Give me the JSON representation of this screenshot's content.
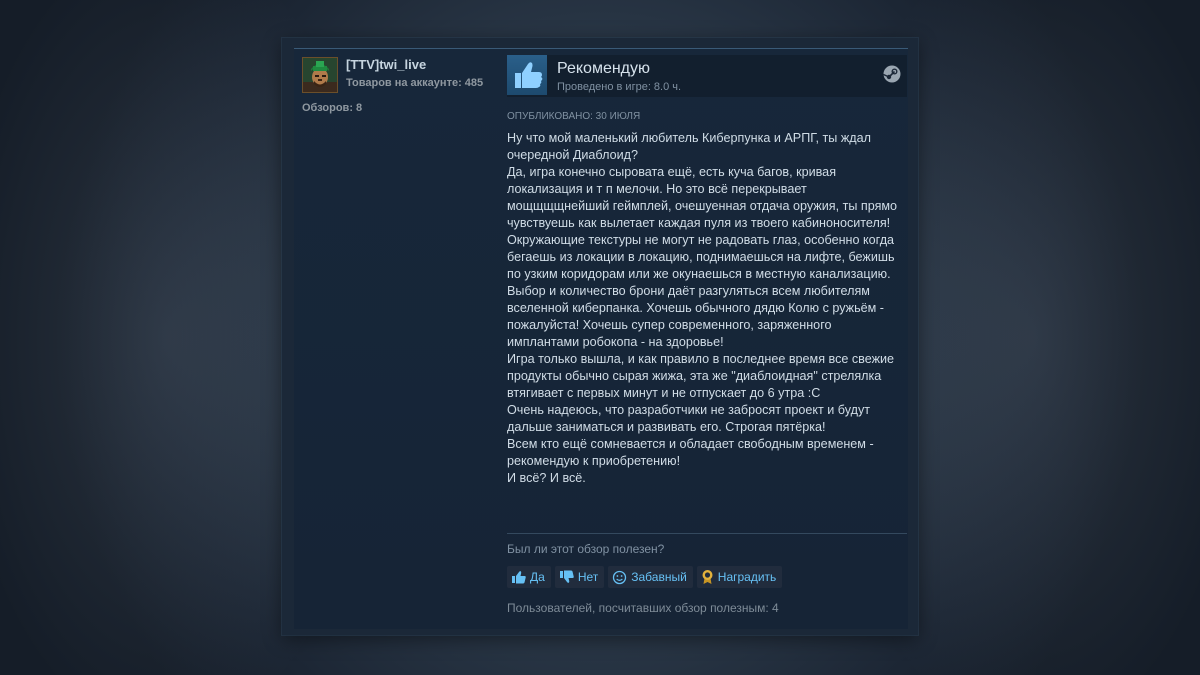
{
  "user": {
    "name": "[TTV]twi_live",
    "products_label": "Товаров на аккаунте: 485",
    "reviews_label": "Обзоров: 8",
    "avatar_icon": "user-avatar-icon"
  },
  "review": {
    "verdict": "Рекомендую",
    "playtime": "Проведено в игре: 8.0 ч.",
    "posted": "Опубликовано: 30 июля",
    "paragraphs": [
      "Ну что мой маленький любитель Киберпунка и АРПГ, ты ждал очередной Диаблоид?",
      "Да, игра конечно сыровата ещё, есть куча багов, кривая локализация и т п мелочи. Но это всё перекрывает мощщщщнейший геймплей, очешуенная отдача оружия, ты прямо чувствуешь как вылетает каждая пуля из твоего кабиноносителя!",
      "Окружающие текстуры не могут не радовать глаз, особенно когда бегаешь из локации в локацию, поднимаешься на лифте, бежишь по узким коридорам или же окунаешься в местную канализацию.",
      "Выбор и количество брони даёт разгуляться всем любителям вселенной киберпанка. Хочешь обычного дядю Колю с ружьём - пожалуйста! Хочешь супер современного, заряженного имплантами робокопа - на здоровье!",
      "Игра только вышла, и как правило в последнее время все свежие продукты обычно сырая жижа, эта же \"диаблоидная\" стрелялка втягивает с первых минут и не отпускает до 6 утра :C",
      "Очень надеюсь, что разработчики не забросят проект и будут дальше заниматься и развивать его. Строгая пятёрка!",
      "Всем кто ещё сомневается и обладает свободным временем - рекомендую к приобретению!",
      "И всё? И всё."
    ],
    "icons": {
      "verdict": "thumbs-up-icon",
      "platform": "steam-icon"
    }
  },
  "feedback": {
    "question": "Был ли этот обзор полезен?",
    "buttons": {
      "yes": "Да",
      "no": "Нет",
      "funny": "Забавный",
      "award": "Наградить"
    },
    "helpful_count": "Пользователей, посчитавших обзор полезным: 4"
  },
  "colors": {
    "accent": "#66c0f4",
    "card_bg": "#1b2838",
    "text": "#d0dce6",
    "muted": "#8091a2",
    "award": "#e3b23c"
  }
}
